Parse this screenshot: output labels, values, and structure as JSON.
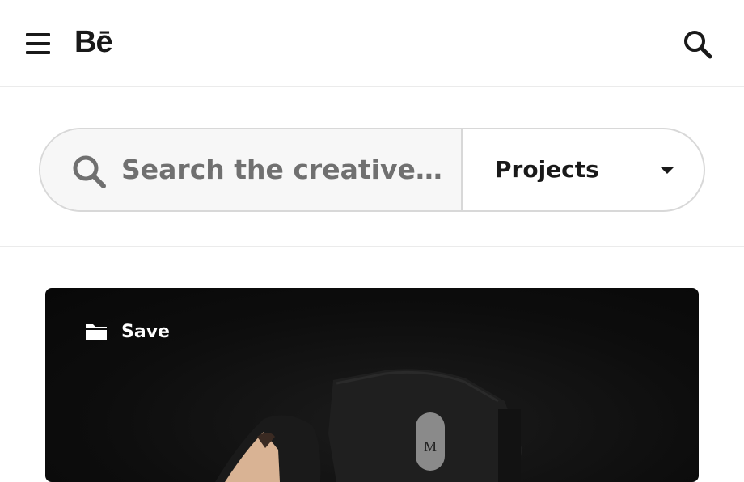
{
  "header": {
    "logo_text": "Bē",
    "menu_icon": "hamburger-menu-icon",
    "search_icon": "search-icon"
  },
  "search": {
    "placeholder": "Search the creative ...",
    "category_selected": "Projects",
    "dropdown_icon": "caret-down-icon"
  },
  "project_card": {
    "save_label": "Save",
    "save_icon": "folder-icon",
    "badge_letter": "M"
  },
  "colors": {
    "text": "#191919",
    "placeholder": "#707070",
    "border": "#d8d8d8",
    "divider": "#ebebeb",
    "card_bg": "#0d0d0d"
  }
}
